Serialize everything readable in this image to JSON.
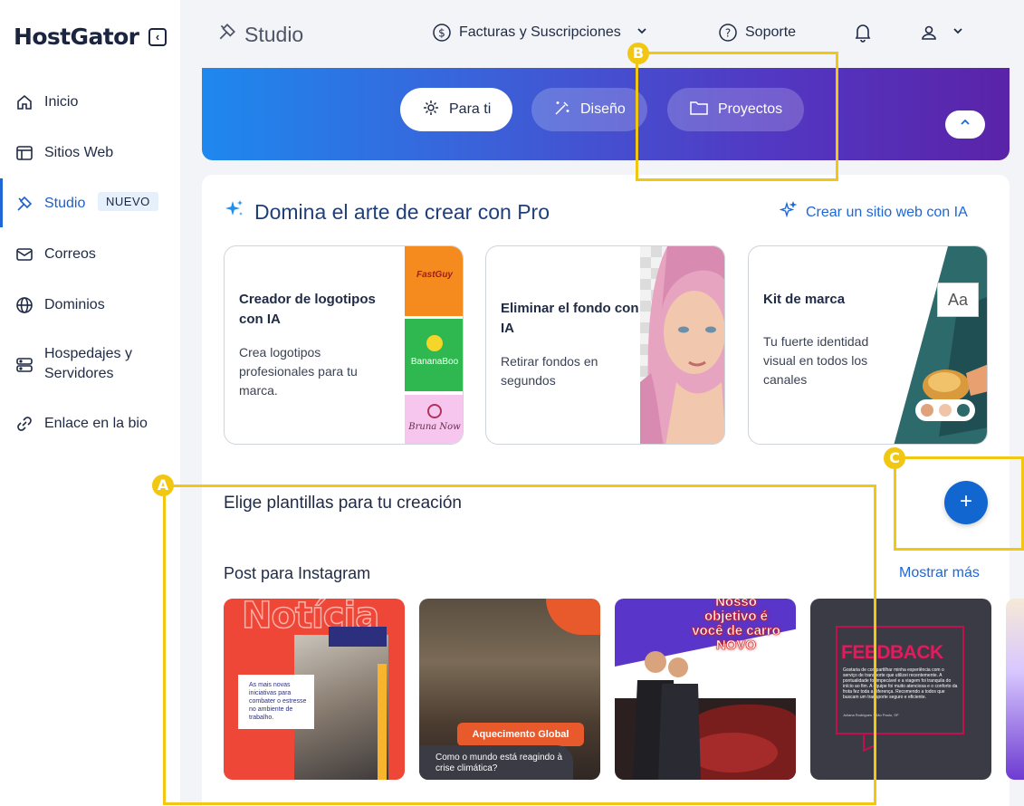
{
  "brand": {
    "name": "HostGator"
  },
  "sidebar": {
    "items": [
      {
        "label": "Inicio",
        "icon": "home-icon"
      },
      {
        "label": "Sitios Web",
        "icon": "layout-icon"
      },
      {
        "label": "Studio",
        "icon": "studio-icon",
        "badge": "NUEVO",
        "active": true
      },
      {
        "label": "Correos",
        "icon": "mail-icon"
      },
      {
        "label": "Dominios",
        "icon": "globe-icon"
      },
      {
        "label": "Hospedajes y Servidores",
        "icon": "server-icon"
      },
      {
        "label": "Enlace en la bio",
        "icon": "link-icon"
      }
    ]
  },
  "topbar": {
    "title": "Studio",
    "billing": "Facturas y Suscripciones",
    "support": "Soporte"
  },
  "hero": {
    "tabs": [
      "Para ti",
      "Diseño",
      "Proyectos"
    ],
    "active_tab": "Para ti"
  },
  "featured": {
    "title": "Domina el arte de crear con Pro",
    "ai_link": "Crear un sitio web con IA",
    "cards": [
      {
        "title": "Creador de logotipos con IA",
        "desc": "Crea logotipos profesionales para tu marca.",
        "logo_texts": [
          "FastGuy",
          "BananaBoo",
          "Bruna Now"
        ]
      },
      {
        "title": "Eliminar el fondo con IA",
        "desc": "Retirar fondos en segundos"
      },
      {
        "title": "Kit de marca",
        "desc": "Tu fuerte identidad visual en todos los canales",
        "sample": "Aa"
      }
    ]
  },
  "templates": {
    "heading": "Elige plantillas para tu creación",
    "category": "Post para Instagram",
    "show_more": "Mostrar más",
    "add_label": "+",
    "items": [
      {
        "headline": "Notícia",
        "body": "As mais novas iniciativas para combater o estresse no ambiente de trabalho."
      },
      {
        "tag": "Aquecimento Global",
        "body": "Como o mundo  está reagindo à crise climática?"
      },
      {
        "headline": "Nosso objetivo é você de carro NOVO"
      },
      {
        "headline": "FEEDBACK",
        "body": "Gostaria de compartilhar minha experiência com o serviço de transporte que utilizei recentemente. A pontualidade foi impecável e a viagem foi tranquila do início ao fim. A equipe foi muito atenciosa e o conforto da frota fez toda a diferença. Recomendo a todos que buscam um transporte seguro e eficiente.",
        "author": "Juliana Rodrigues · São Paulo, SP"
      }
    ]
  },
  "annotations": {
    "A": "A",
    "B": "B",
    "C": "C"
  },
  "colors": {
    "accent": "#1f66d6",
    "annotation": "#f2c712",
    "hero_start": "#1e88ee",
    "hero_end": "#5a23a8"
  }
}
